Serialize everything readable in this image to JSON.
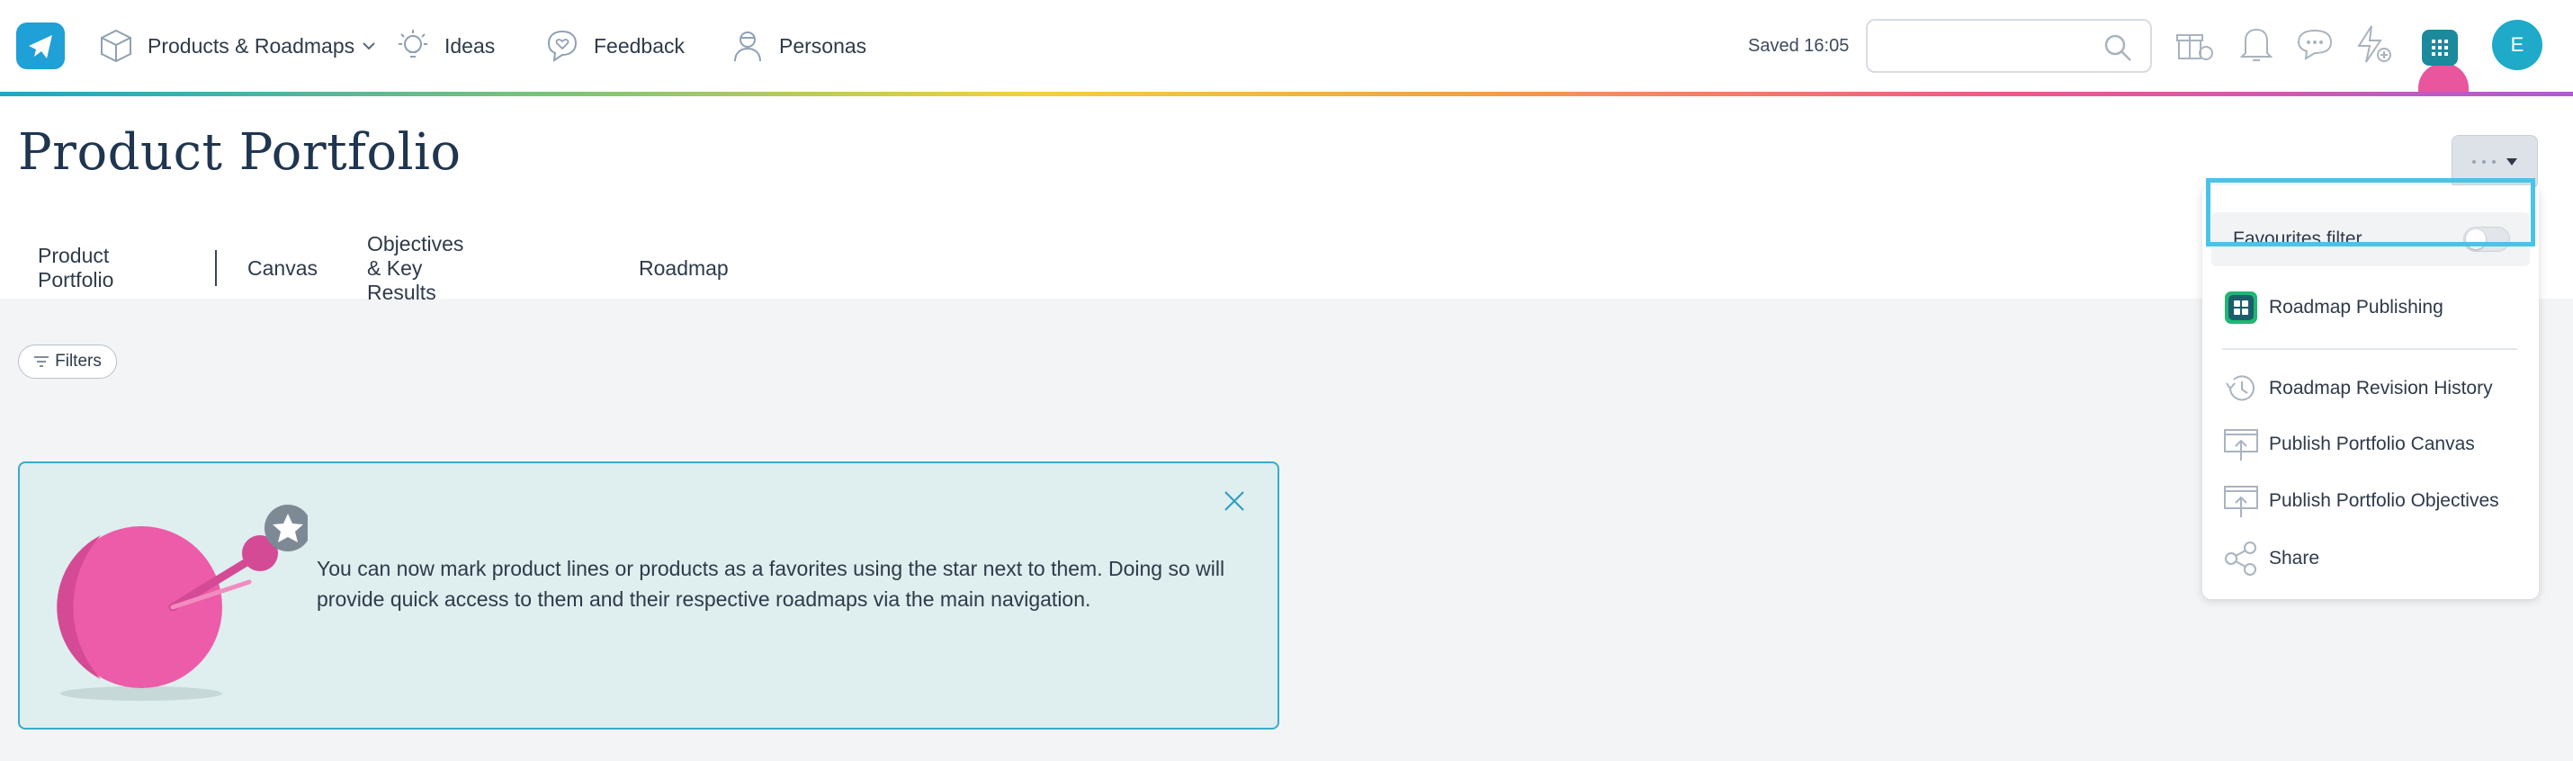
{
  "nav": {
    "items": [
      {
        "label": "Products & Roadmaps",
        "icon": "cube-icon"
      },
      {
        "label": "Ideas",
        "icon": "lightbulb-icon"
      },
      {
        "label": "Feedback",
        "icon": "heart-chat-icon"
      },
      {
        "label": "Personas",
        "icon": "person-icon"
      }
    ],
    "saved_text": "Saved 16:05",
    "search_placeholder": "",
    "avatar_initial": "E"
  },
  "page": {
    "title": "Product Portfolio",
    "tabs": [
      "Product Portfolio",
      "Canvas",
      "Objectives & Key Results",
      "Roadmap"
    ],
    "filters_label": "Filters"
  },
  "notice": {
    "text": "You can now mark product lines or products as a favorites using the star next to them. Doing so will provide quick access to them and their respective roadmaps via the main navigation."
  },
  "dropdown": {
    "favourites_filter_label": "Favourites filter",
    "favourites_filter_on": false,
    "items": [
      {
        "label": "Roadmap Publishing",
        "icon": "apps-grid-icon"
      },
      {
        "label": "Roadmap Revision History",
        "icon": "history-icon"
      },
      {
        "label": "Publish Portfolio Canvas",
        "icon": "publish-icon"
      },
      {
        "label": "Publish Portfolio Objectives",
        "icon": "publish-icon"
      },
      {
        "label": "Share",
        "icon": "share-icon"
      }
    ]
  },
  "colors": {
    "accent": "#1fa0d6",
    "highlight": "#47c4ea",
    "notice_bg": "#dfeeee",
    "pink": "#e9569d"
  }
}
